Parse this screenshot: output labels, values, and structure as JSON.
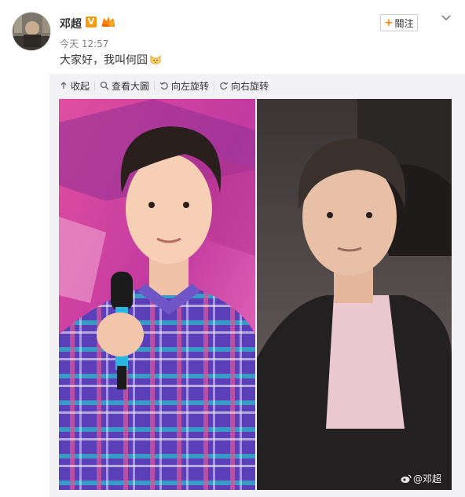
{
  "post": {
    "username": "邓超",
    "verified_badge": "V",
    "time_label": "今天",
    "time_value": "12:57",
    "text": "大家好，我叫何囧",
    "follow_button": "關注",
    "follow_plus": "+"
  },
  "toolbar": {
    "items": [
      {
        "icon": "collapse-icon",
        "label": "收起"
      },
      {
        "icon": "zoom-icon",
        "label": "查看大圖"
      },
      {
        "icon": "rotate-left-icon",
        "label": "向左旋转"
      },
      {
        "icon": "rotate-right-icon",
        "label": "向右旋转"
      }
    ]
  },
  "photo": {
    "watermark": "@邓超"
  },
  "colors": {
    "accent": "#ff8200",
    "verified": "#f39c12",
    "media_bg": "#f2f2f5",
    "text": "#333333",
    "muted": "#808080"
  }
}
